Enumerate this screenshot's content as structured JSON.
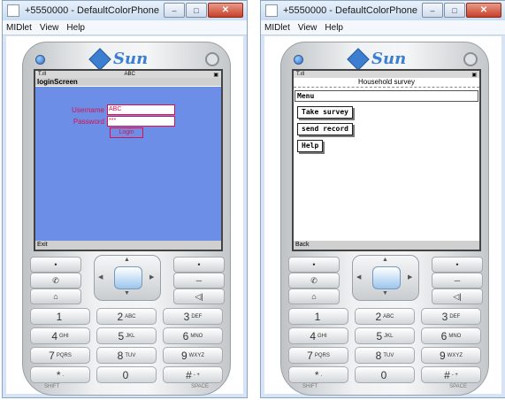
{
  "windows": [
    {
      "title": "+5550000 - DefaultColorPhone",
      "menu": [
        "MIDlet",
        "View",
        "Help"
      ],
      "logo": "Sun",
      "status_right": "ABC",
      "screen_title": "loginScreen",
      "username_label": "Username",
      "username_value": "ABC",
      "password_label": "Password",
      "password_value": "***",
      "login_button": "Login",
      "soft_left": "Exit"
    },
    {
      "title": "+5550000 - DefaultColorPhone",
      "menu": [
        "MIDlet",
        "View",
        "Help"
      ],
      "logo": "Sun",
      "screen_title": "Household survey",
      "menu_header": "Menu",
      "items": [
        "Take survey",
        "send record",
        "Help"
      ],
      "soft_left": "Back"
    }
  ],
  "keys": [
    {
      "main": "1",
      "sub": ""
    },
    {
      "main": "2",
      "sub": "ABC"
    },
    {
      "main": "3",
      "sub": "DEF"
    },
    {
      "main": "4",
      "sub": "GHI"
    },
    {
      "main": "5",
      "sub": "JKL"
    },
    {
      "main": "6",
      "sub": "MNO"
    },
    {
      "main": "7",
      "sub": "PQRS"
    },
    {
      "main": "8",
      "sub": "TUV"
    },
    {
      "main": "9",
      "sub": "WXYZ"
    },
    {
      "main": "*",
      "sub": "."
    },
    {
      "main": "0",
      "sub": ""
    },
    {
      "main": "#",
      "sub": "- +"
    }
  ],
  "key_labels": {
    "shift": "SHIFT",
    "space": "SPACE"
  },
  "colors": {
    "login_bg": "#6d8ee6",
    "login_text": "#d81050",
    "brand": "#3c7fd0"
  }
}
